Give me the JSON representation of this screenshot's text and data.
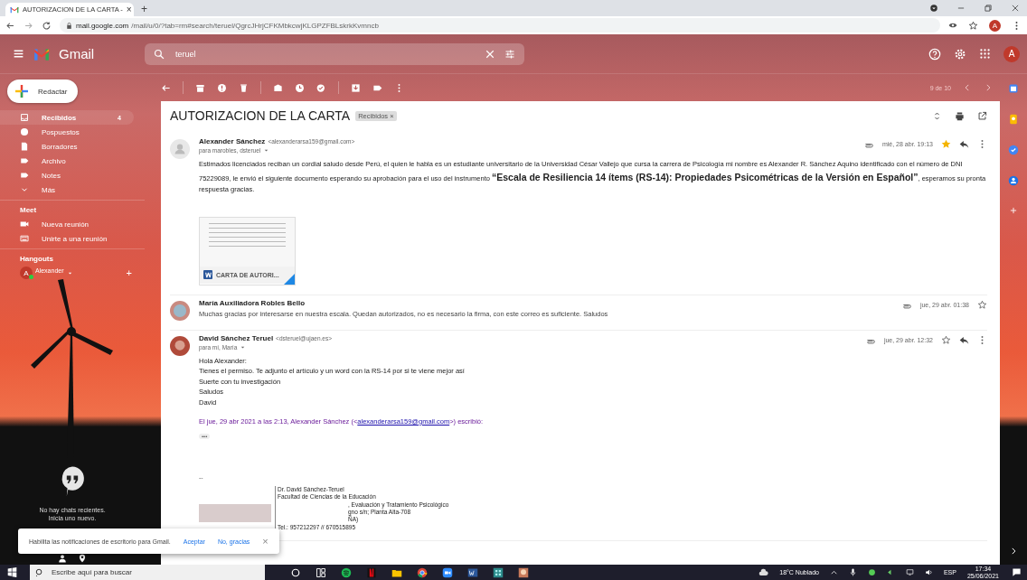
{
  "browser": {
    "tab_title": "AUTORIZACION DE LA CARTA - ",
    "tab_close": "×",
    "new_tab": "+",
    "url_host": "mail.google.com",
    "url_path": "/mail/u/0/?tab=rm#search/teruel/QgrcJHrjCFKMbkcwjKLGPZFBLskrkKvmncb",
    "profile_initial": "A"
  },
  "header": {
    "app_name": "Gmail",
    "search": {
      "value": "teruel"
    },
    "profile_initial": "A"
  },
  "compose": {
    "label": "Redactar"
  },
  "sidebar": {
    "items": [
      {
        "label": "Recibidos",
        "count": "4",
        "selected": true,
        "kind": "inbox"
      },
      {
        "label": "Pospuestos",
        "selected": false,
        "kind": "clock"
      },
      {
        "label": "Borradores",
        "selected": false,
        "kind": "file"
      },
      {
        "label": "Archivo",
        "selected": false,
        "kind": "label"
      },
      {
        "label": "Notes",
        "selected": false,
        "kind": "label"
      },
      {
        "label": "Más",
        "selected": false,
        "kind": "chevron"
      }
    ]
  },
  "meet": {
    "title": "Meet",
    "items": [
      {
        "label": "Nueva reunión",
        "kind": "camera"
      },
      {
        "label": "Unirte a una reunión",
        "kind": "keyboard"
      }
    ]
  },
  "hangouts": {
    "title": "Hangouts",
    "user": {
      "initial": "A",
      "name": "Alexander",
      "online": true
    },
    "add": "+",
    "empty_lines": [
      "No hay chats recientes.",
      "Inicia uno nuevo."
    ]
  },
  "toolbar": {
    "pagination": "9 de 10"
  },
  "thread": {
    "subject": "AUTORIZACION DE LA CARTA",
    "label_chip": "Recibidos",
    "label_close": "×",
    "messages": [
      {
        "kind": "expanded",
        "sender": "Alexander Sánchez",
        "email": "<alexanderarsa159@gmail.com>",
        "recipients": "para marobles, dsteruel",
        "date": "mié, 28 abr. 19:13",
        "starred": true,
        "has_attachment": true,
        "body": [
          "Estimados licenciados reciban un cordial saludo desde Perú, el quien le habla es un estudiante universitario de la Universidad César Vallejo que cursa la carrera de Psicología mi nombre es Alexander R.  Sánchez Aquino identificado con el número de DNI 75229089, le envió el siguiente documento esperando su aprobación para el uso del instrumento  **“Escala de Resiliencia 14 ítems (RS-14): Propiedades Psicométricas de la Versión en Español”**, esperamos su pronta respuesta gracias."
        ],
        "attachment": {
          "name": "CARTA DE AUTORI..."
        }
      },
      {
        "kind": "collapsed",
        "sender": "María Auxiliadora Robles Bello",
        "snippet": "Muchas gracias por interesarse en nuestra escala. Quedan autorizados, no es necesario la firma, con este correo es suficiente. Saludos",
        "date": "jue, 29 abr. 01:38",
        "starred": false,
        "has_attachment": true
      },
      {
        "kind": "expanded",
        "sender": "David Sánchez Teruel",
        "email": "<dsteruel@ujaen.es>",
        "recipients": "para mí, María",
        "date": "jue, 29 abr. 12:32",
        "starred": false,
        "has_attachment": true,
        "body": [
          "Hola Alexander:",
          "Tienes el permiso. Te adjunto el artículo y un word con la RS-14 por si te viene mejor así",
          "Suerte con tu investigación",
          "Saludos",
          "David"
        ],
        "quote": {
          "before": "El jue, 29 abr 2021 a las 2:13, Alexander Sánchez (<",
          "link": "alexanderarsa159@gmail.com",
          "after": ">) escribió:"
        },
        "ellipsis": "•••",
        "separator": "--",
        "signature": [
          {
            "text": "Dr. David Sánchez-Teruel",
            "cut": false
          },
          {
            "text": "Facultad de Ciencias de la Educación",
            "cut": false
          },
          {
            "text": ", Evaluación y Tratamiento Psicológico",
            "cut": true
          },
          {
            "text": "gno s/n; Planta Alta-708",
            "cut": true
          },
          {
            "text": "ÑA)",
            "cut": true
          },
          {
            "text": "Tel.: 957212297 // 670515895",
            "cut": false
          }
        ]
      }
    ]
  },
  "snackbar": {
    "text": "Habilita las notificaciones de escritorio para Gmail.",
    "accept": "Aceptar",
    "decline": "No, gracias",
    "close": "×"
  },
  "taskbar": {
    "search_placeholder": "Escribe aquí para buscar",
    "weather": "18°C Nublado",
    "language": "ESP",
    "time": "17:34",
    "date": "25/06/2021"
  }
}
